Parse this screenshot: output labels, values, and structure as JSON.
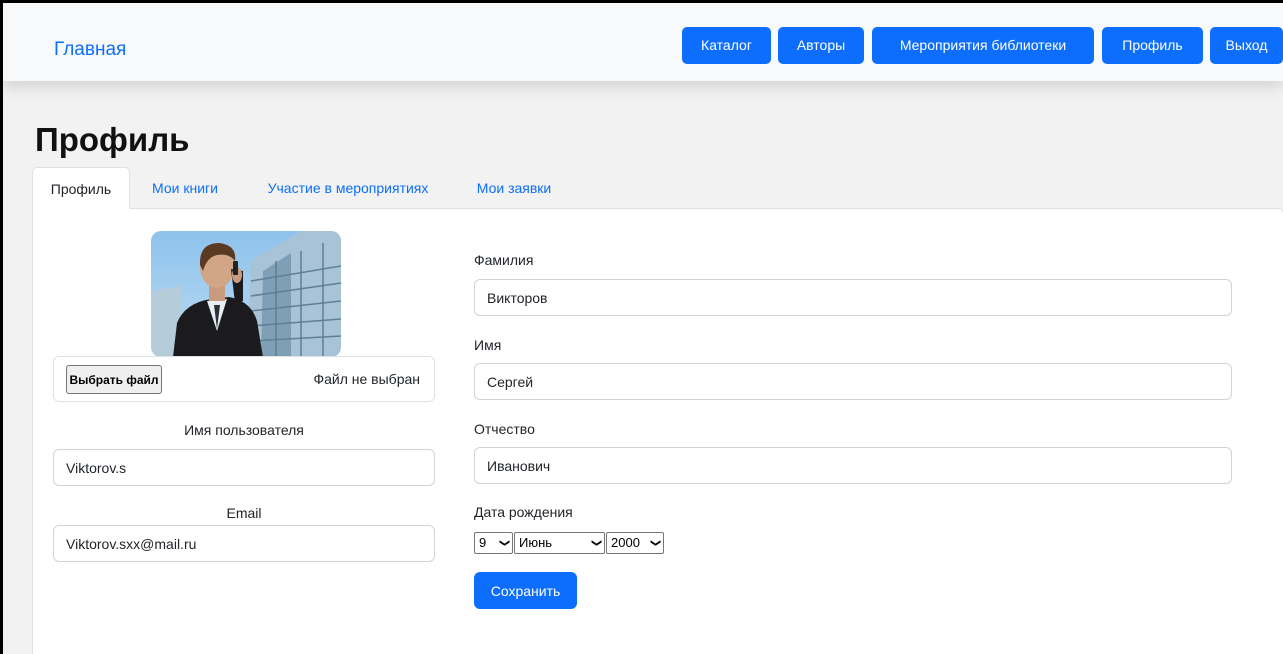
{
  "navbar": {
    "brand": "Главная",
    "buttons": [
      "Каталог",
      "Авторы",
      "Мероприятия библиотеки",
      "Профиль",
      "Выход"
    ]
  },
  "page": {
    "title": "Профиль",
    "tabs": [
      "Профиль",
      "Мои книги",
      "Участие в мероприятиях",
      "Мои заявки"
    ]
  },
  "left": {
    "file_button": "Выбрать файл",
    "file_status": "Файл не выбран",
    "username_label": "Имя пользователя",
    "username_value": "Viktorov.s",
    "email_label": "Email",
    "email_value": "Viktorov.sxx@mail.ru"
  },
  "right": {
    "surname_label": "Фамилия",
    "surname_value": "Викторов",
    "name_label": "Имя",
    "name_value": "Сергей",
    "patronymic_label": "Отчество",
    "patronymic_value": "Иванович",
    "birthdate_label": "Дата рождения",
    "birth_day": "9",
    "birth_month": "Июнь",
    "birth_year": "2000",
    "save_button": "Сохранить"
  },
  "colors": {
    "primary": "#0d6efd",
    "navbar_bg": "#f8f9fa",
    "page_bg": "#f2f2f2"
  }
}
